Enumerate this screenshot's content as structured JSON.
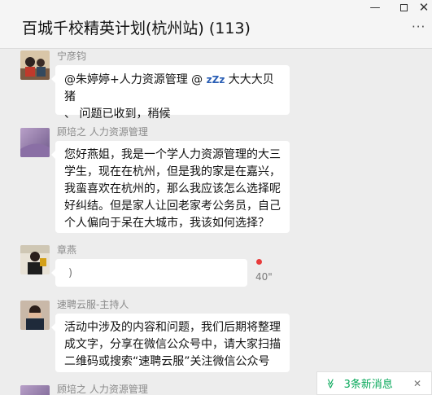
{
  "header": {
    "title": "百城千校精英计划(杭州站) (113)",
    "minimize_glyph": "—",
    "close_glyph": "✕",
    "more_glyph": "···"
  },
  "messages": [
    {
      "sender": "宁彦钧",
      "lines": [
        "@朱婷婷+人力资源管理 @ ",
        "大大大贝猪",
        "、 问题已收到，稍候"
      ],
      "emoji_name": "zzz-icon",
      "emoji_text": "zZz"
    },
    {
      "sender": "顾培之 人力资源管理",
      "lines": [
        "您好燕姐，我是一个学人力资源管理的大三",
        "学生，现在在杭州，但是我的家是在嘉兴，",
        "我蛮喜欢在杭州的，那么我应该怎么选择呢",
        "好纠结。但是家人让回老家考公务员，自己",
        "个人偏向于呆在大城市，我该如何选择？"
      ]
    },
    {
      "sender": "章燕",
      "voice_icon": ")",
      "voice_duration": "40\""
    },
    {
      "sender": "速聘云服-主持人",
      "lines": [
        "活动中涉及的内容和问题，我们后期将整理",
        "成文字，分享在微信公众号中，请大家扫描",
        "二维码或搜索“速聘云服”关注微信公众号"
      ]
    },
    {
      "sender": "顾培之 人力资源管理"
    }
  ],
  "new_messages": {
    "label": "3条新消息",
    "chevron": "≫",
    "close": "✕"
  },
  "colors": {
    "background": "#ededed",
    "bubble": "#ffffff",
    "accent_green": "#07a85a",
    "unread_dot": "#e83b3b"
  }
}
